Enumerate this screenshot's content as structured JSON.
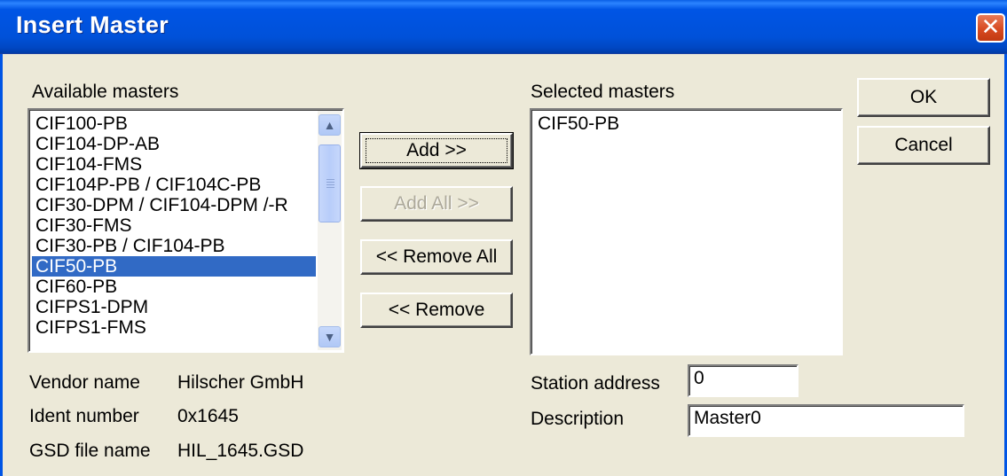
{
  "window": {
    "title": "Insert Master",
    "close_icon": "close-icon"
  },
  "available": {
    "label": "Available masters",
    "items": [
      "CIF100-PB",
      "CIF104-DP-AB",
      "CIF104-FMS",
      "CIF104P-PB / CIF104C-PB",
      "CIF30-DPM / CIF104-DPM /-R",
      "CIF30-FMS",
      "CIF30-PB / CIF104-PB",
      "CIF50-PB",
      "CIF60-PB",
      "CIFPS1-DPM",
      "CIFPS1-FMS"
    ],
    "selected": "CIF50-PB"
  },
  "buttons": {
    "add": "Add >>",
    "add_all": "Add All >>",
    "remove_all": "<< Remove All",
    "remove": "<< Remove",
    "ok": "OK",
    "cancel": "Cancel"
  },
  "selected": {
    "label": "Selected masters",
    "items": [
      "CIF50-PB"
    ]
  },
  "info": {
    "vendor_label": "Vendor name",
    "vendor_value": "Hilscher GmbH",
    "ident_label": "Ident number",
    "ident_value": "0x1645",
    "gsd_label": "GSD file name",
    "gsd_value": "HIL_1645.GSD"
  },
  "station": {
    "label": "Station address",
    "value": "0"
  },
  "description": {
    "label": "Description",
    "value": "Master0"
  }
}
